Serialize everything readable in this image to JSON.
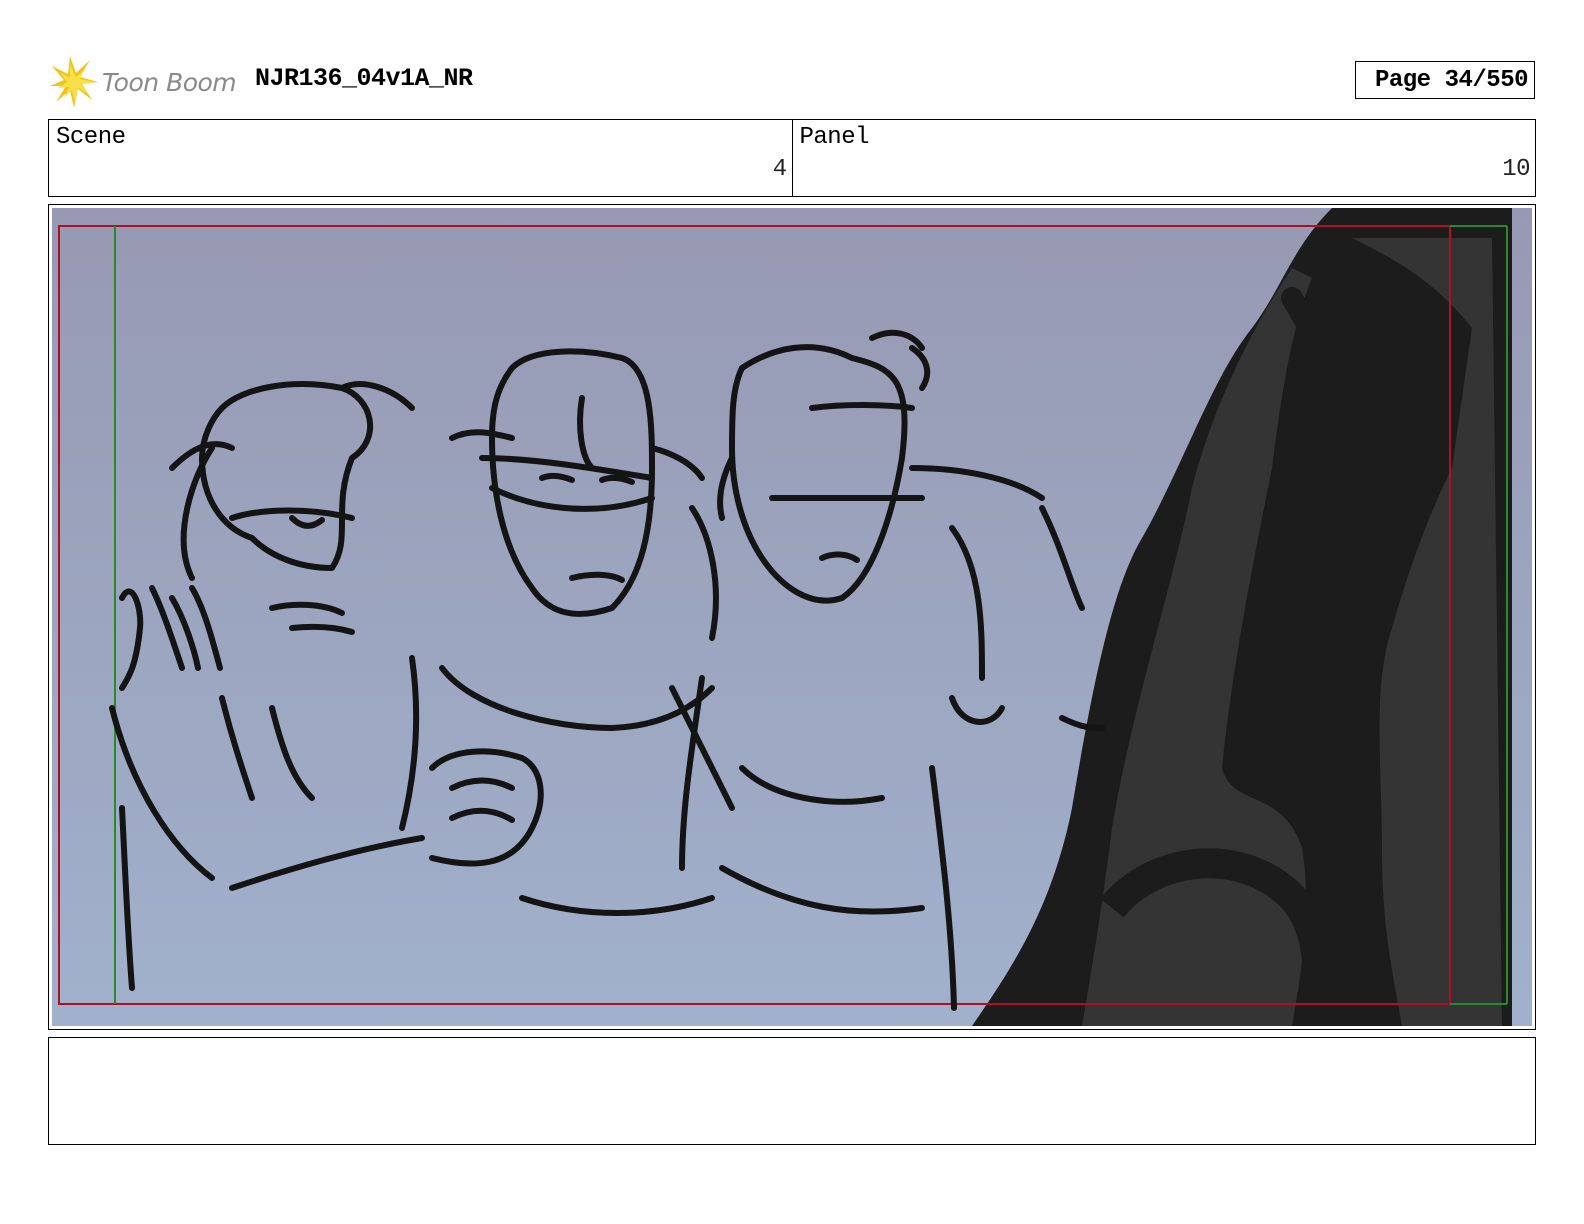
{
  "header": {
    "logo_text": "Toon Boom",
    "logo_icon": "starburst-logo-icon",
    "project_title": "NJR136_04v1A_NR",
    "page_label": "Page",
    "page_number": "34/550"
  },
  "info": {
    "scene_label": "Scene",
    "scene_value": "4",
    "panel_label": "Panel",
    "panel_value": "10"
  },
  "colors": {
    "sky_top": "#9799b3",
    "sky_bottom": "#a1b1cc",
    "safe_frame_red": "#b01020",
    "safe_line_green": "#2a8a2a",
    "foreground_dark": "#1c1c1c",
    "foreground_mid": "#343434",
    "logo_yellow": "#f2c417"
  },
  "notes": {
    "text": ""
  }
}
